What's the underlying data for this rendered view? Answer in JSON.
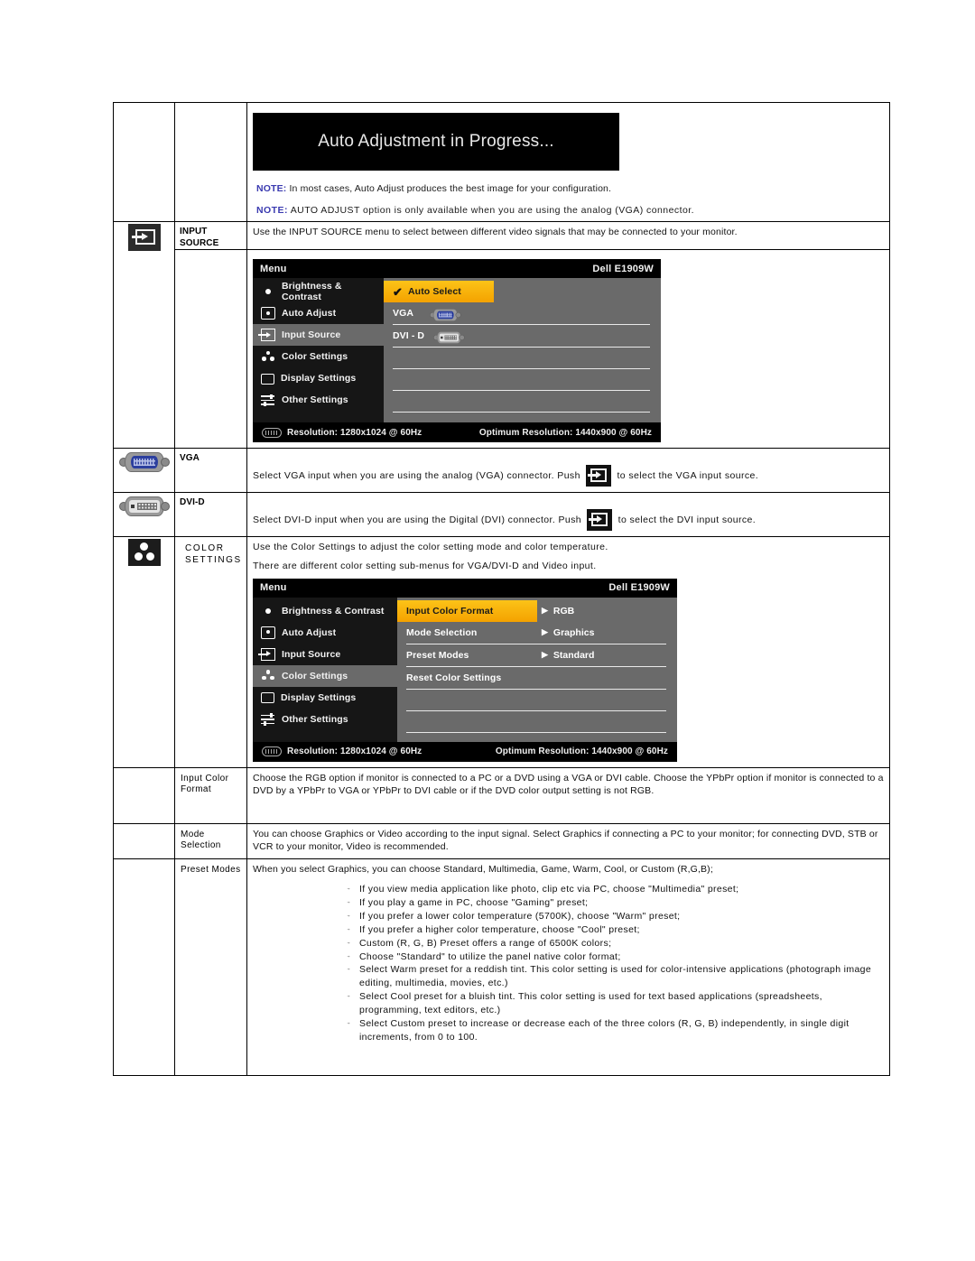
{
  "banner": {
    "text": "Auto Adjustment in Progress..."
  },
  "notes": [
    {
      "keyword": "NOTE:",
      "text": " In most cases, Auto Adjust produces the best image for your configuration."
    },
    {
      "keyword": "NOTE:",
      "text": " AUTO ADJUST option is only available when you are using the analog (VGA) connector."
    }
  ],
  "rows": {
    "input_source": {
      "label": "INPUT SOURCE",
      "icon": "input-source-icon",
      "description": "Use the INPUT SOURCE menu to select between different video signals that may be connected to your monitor."
    },
    "vga": {
      "label": "VGA",
      "icon": "vga-connector-icon",
      "text_before": "Select VGA input when you are using the analog (VGA) connector. Push",
      "text_after": "to select the VGA input source."
    },
    "dvid": {
      "label": "DVI-D",
      "icon": "dvi-connector-icon",
      "text_before": "Select DVI-D input when you are using the Digital (DVI) connector. Push",
      "text_after": "to select the DVI input source."
    },
    "color_settings": {
      "label": "COLOR SETTINGS",
      "icon": "color-settings-icon",
      "line1": "Use the Color Settings to adjust the color setting mode and color temperature.",
      "line2": "There are different color setting sub-menus for VGA/DVI-D and Video input."
    },
    "input_color_format": {
      "label": "Input Color Format",
      "description": "Choose the RGB option if monitor is connected to a PC or a DVD using a VGA or DVI cable. Choose the YPbPr option if monitor is connected to a DVD by a YPbPr to VGA or YPbPr to DVI cable or if the DVD color output setting is not RGB."
    },
    "mode_selection": {
      "label": "Mode Selection",
      "description": "You can choose Graphics or Video according to the input signal. Select Graphics if connecting a PC to your monitor; for connecting DVD, STB or VCR to your monitor, Video is recommended."
    },
    "preset_modes": {
      "label": "Preset Modes",
      "intro": "When you select Graphics, you can choose Standard, Multimedia, Game, Warm, Cool, or Custom (R,G,B);",
      "bullets": [
        "If you view media application like photo, clip etc via PC, choose \"Multimedia\" preset;",
        "If you play a game in PC, choose \"Gaming\" preset;",
        "If you prefer a lower color temperature (5700K), choose \"Warm\" preset;",
        "If you prefer a higher color temperature, choose \"Cool\" preset;",
        "Custom (R, G, B) Preset offers a range of 6500K colors;",
        "Choose \"Standard\" to utilize the panel native color format;",
        "Select Warm preset for a reddish tint. This color setting is used for color-intensive applications (photograph image editing, multimedia, movies, etc.)",
        "Select Cool preset for a bluish tint. This color setting is used for text based applications (spreadsheets, programming, text editors, etc.)",
        "Select Custom preset to increase or decrease each of the three colors (R, G, B) independently, in single digit increments, from 0 to 100."
      ]
    }
  },
  "osd_input_source": {
    "title": "Menu",
    "model": "Dell E1909W",
    "menu_items": [
      {
        "label": "Brightness & Contrast",
        "icon": "brightness-icon",
        "selected": false
      },
      {
        "label": "Auto Adjust",
        "icon": "auto-adjust-icon",
        "selected": false
      },
      {
        "label": "Input Source",
        "icon": "input-source-icon",
        "selected": true
      },
      {
        "label": "Color Settings",
        "icon": "color-settings-icon",
        "selected": false
      },
      {
        "label": "Display Settings",
        "icon": "display-settings-icon",
        "selected": false
      },
      {
        "label": "Other Settings",
        "icon": "other-settings-icon",
        "selected": false
      }
    ],
    "options": [
      {
        "label": "Auto Select",
        "highlighted": true,
        "checked": true,
        "value": ""
      },
      {
        "label": "VGA",
        "highlighted": false,
        "checked": false,
        "value": ""
      },
      {
        "label": "DVI - D",
        "highlighted": false,
        "checked": false,
        "value": ""
      }
    ],
    "footer_resolution": "Resolution: 1280x1024 @ 60Hz",
    "footer_optimum": "Optimum Resolution: 1440x900 @ 60Hz"
  },
  "osd_color_settings": {
    "title": "Menu",
    "model": "Dell E1909W",
    "menu_items": [
      {
        "label": "Brightness & Contrast",
        "icon": "brightness-icon",
        "selected": false
      },
      {
        "label": "Auto Adjust",
        "icon": "auto-adjust-icon",
        "selected": false
      },
      {
        "label": "Input Source",
        "icon": "input-source-icon",
        "selected": false
      },
      {
        "label": "Color Settings",
        "icon": "color-settings-icon",
        "selected": true
      },
      {
        "label": "Display Settings",
        "icon": "display-settings-icon",
        "selected": false
      },
      {
        "label": "Other Settings",
        "icon": "other-settings-icon",
        "selected": false
      }
    ],
    "options": [
      {
        "label": "Input Color Format",
        "highlighted": true,
        "value": "RGB"
      },
      {
        "label": "Mode Selection",
        "highlighted": false,
        "value": "Graphics"
      },
      {
        "label": "Preset Modes",
        "highlighted": false,
        "value": "Standard"
      },
      {
        "label": "Reset Color Settings",
        "highlighted": false,
        "value": ""
      }
    ],
    "footer_resolution": "Resolution: 1280x1024 @ 60Hz",
    "footer_optimum": "Optimum Resolution: 1440x900 @ 60Hz"
  },
  "colors": {
    "highlight": "#f4a200",
    "osd_bg": "#6a6a6a",
    "osd_panel": "#161616",
    "note_keyword": "#3a3ab0"
  }
}
